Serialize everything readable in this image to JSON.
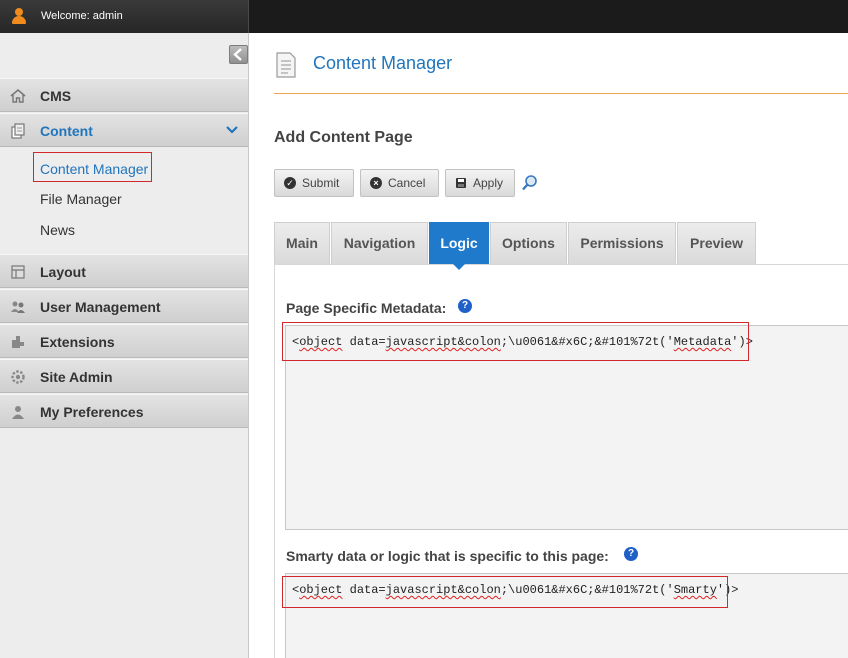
{
  "topbar": {
    "welcome": "Welcome: admin"
  },
  "sidebar": {
    "items": [
      {
        "label": "CMS"
      },
      {
        "label": "Content"
      },
      {
        "label": "Layout"
      },
      {
        "label": "User Management"
      },
      {
        "label": "Extensions"
      },
      {
        "label": "Site Admin"
      },
      {
        "label": "My Preferences"
      }
    ],
    "subitems": [
      {
        "label": "Content Manager"
      },
      {
        "label": "File Manager"
      },
      {
        "label": "News"
      }
    ]
  },
  "main": {
    "page_title": "Content Manager",
    "section_title": "Add Content Page",
    "buttons": {
      "submit": "Submit",
      "cancel": "Cancel",
      "apply": "Apply"
    },
    "tabs": [
      {
        "label": "Main"
      },
      {
        "label": "Navigation"
      },
      {
        "label": "Logic"
      },
      {
        "label": "Options"
      },
      {
        "label": "Permissions"
      },
      {
        "label": "Preview"
      }
    ],
    "active_tab": "Logic",
    "fields": {
      "metadata": {
        "label": "Page Specific Metadata:",
        "value_parts": [
          "<",
          "object",
          " data=",
          "javascript&colon",
          ";\\u0061&#x6C;&#101%72t('",
          "Metadata",
          "')>"
        ]
      },
      "smarty": {
        "label": "Smarty data or logic that is specific to this page:",
        "value_parts": [
          "<",
          "object",
          " data=",
          "javascript&colon",
          ";\\u0061&#x6C;&#101%72t('",
          "Smarty",
          "')>"
        ]
      }
    }
  },
  "colors": {
    "accent": "#2175bc",
    "highlight_box": "#d0282d",
    "tab_active": "#1f7acc",
    "divider": "#f0a350"
  }
}
